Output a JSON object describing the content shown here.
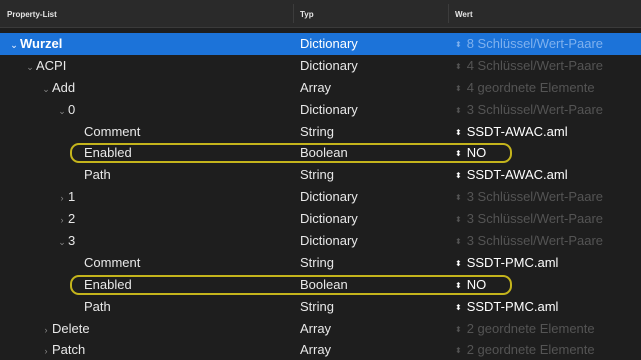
{
  "header": {
    "key_label": "Property-List",
    "type_label": "Typ",
    "value_label": "Wert"
  },
  "rows": [
    {
      "indent": 0,
      "chevron": "expanded",
      "key": "Wurzel",
      "type": "Dictionary",
      "value": "8 Schlüssel/Wert-Paare",
      "dim": true,
      "selected": true,
      "highlight": false
    },
    {
      "indent": 1,
      "chevron": "expanded",
      "key": "ACPI",
      "type": "Dictionary",
      "value": "4 Schlüssel/Wert-Paare",
      "dim": true,
      "selected": false,
      "highlight": false
    },
    {
      "indent": 2,
      "chevron": "expanded",
      "key": "Add",
      "type": "Array",
      "value": "4 geordnete Elemente",
      "dim": true,
      "selected": false,
      "highlight": false
    },
    {
      "indent": 3,
      "chevron": "expanded",
      "key": "0",
      "type": "Dictionary",
      "value": "3 Schlüssel/Wert-Paare",
      "dim": true,
      "selected": false,
      "highlight": false
    },
    {
      "indent": 4,
      "chevron": "none",
      "key": "Comment",
      "type": "String",
      "value": "SSDT-AWAC.aml",
      "dim": false,
      "selected": false,
      "highlight": false
    },
    {
      "indent": 4,
      "chevron": "none",
      "key": "Enabled",
      "type": "Boolean",
      "value": "NO",
      "dim": false,
      "selected": false,
      "highlight": true
    },
    {
      "indent": 4,
      "chevron": "none",
      "key": "Path",
      "type": "String",
      "value": "SSDT-AWAC.aml",
      "dim": false,
      "selected": false,
      "highlight": false
    },
    {
      "indent": 3,
      "chevron": "collapsed",
      "key": "1",
      "type": "Dictionary",
      "value": "3 Schlüssel/Wert-Paare",
      "dim": true,
      "selected": false,
      "highlight": false
    },
    {
      "indent": 3,
      "chevron": "collapsed",
      "key": "2",
      "type": "Dictionary",
      "value": "3 Schlüssel/Wert-Paare",
      "dim": true,
      "selected": false,
      "highlight": false
    },
    {
      "indent": 3,
      "chevron": "expanded",
      "key": "3",
      "type": "Dictionary",
      "value": "3 Schlüssel/Wert-Paare",
      "dim": true,
      "selected": false,
      "highlight": false
    },
    {
      "indent": 4,
      "chevron": "none",
      "key": "Comment",
      "type": "String",
      "value": "SSDT-PMC.aml",
      "dim": false,
      "selected": false,
      "highlight": false
    },
    {
      "indent": 4,
      "chevron": "none",
      "key": "Enabled",
      "type": "Boolean",
      "value": "NO",
      "dim": false,
      "selected": false,
      "highlight": true
    },
    {
      "indent": 4,
      "chevron": "none",
      "key": "Path",
      "type": "String",
      "value": "SSDT-PMC.aml",
      "dim": false,
      "selected": false,
      "highlight": false
    },
    {
      "indent": 2,
      "chevron": "collapsed",
      "key": "Delete",
      "type": "Array",
      "value": "2 geordnete Elemente",
      "dim": true,
      "selected": false,
      "highlight": false
    },
    {
      "indent": 2,
      "chevron": "collapsed",
      "key": "Patch",
      "type": "Array",
      "value": "2 geordnete Elemente",
      "dim": true,
      "selected": false,
      "highlight": false
    }
  ],
  "colors": {
    "background": "#1e1e1e",
    "selection": "#1c73d9",
    "highlight_ring": "#c4b41c",
    "dim_text": "#545454"
  },
  "icons": {
    "expanded": "chevron-down-icon",
    "collapsed": "chevron-right-icon",
    "value_stepper": "stepper-icon"
  }
}
